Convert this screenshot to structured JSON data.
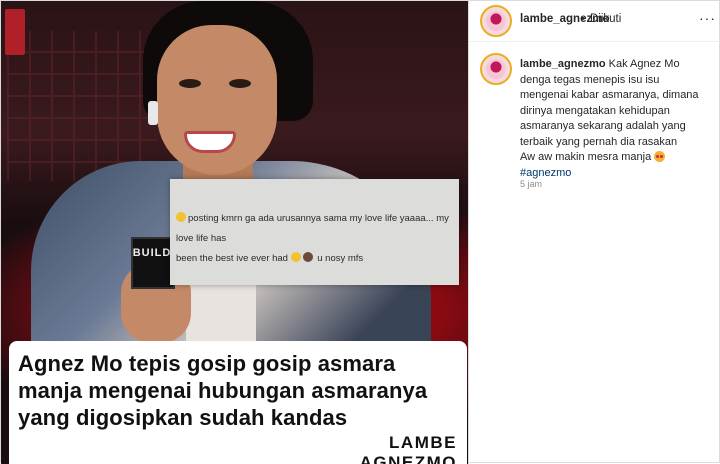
{
  "header": {
    "username": "lambe_agnezmo",
    "separator": "•",
    "follow_status": "Diikuti",
    "more_icon": "more-horizontal-icon",
    "more_label": "···"
  },
  "post_image": {
    "mic_label": "BUILD",
    "note_line1": "posting kmrn ga ada urusannya sama my love life yaaaa... my love life has",
    "note_line2": "been the best ive ever had",
    "note_tail": "u nosy mfs",
    "headline": "Agnez Mo tepis gosip gosip asmara manja mengenai hubungan asmaranya yang digosipkan sudah kandas",
    "brand": "LAMBE AGNEZMO"
  },
  "caption": {
    "username": "lambe_agnezmo",
    "line1": "Kak Agnez Mo",
    "line2": "denga tegas menepis isu isu",
    "line3": "mengenai kabar asmaranya, dimana",
    "line4": "dirinya mengatakan kehidupan",
    "line5": "asmaranya sekarang adalah yang",
    "line6": "terbaik yang pernah dia rasakan",
    "line7": "Aw aw makin mesra manja",
    "hashtag": "#agnezmo",
    "time": "5 jam"
  },
  "colors": {
    "hashtag": "#00376b",
    "text": "#262626",
    "muted": "#8e8e8e",
    "accent_red": "#c8101a"
  }
}
